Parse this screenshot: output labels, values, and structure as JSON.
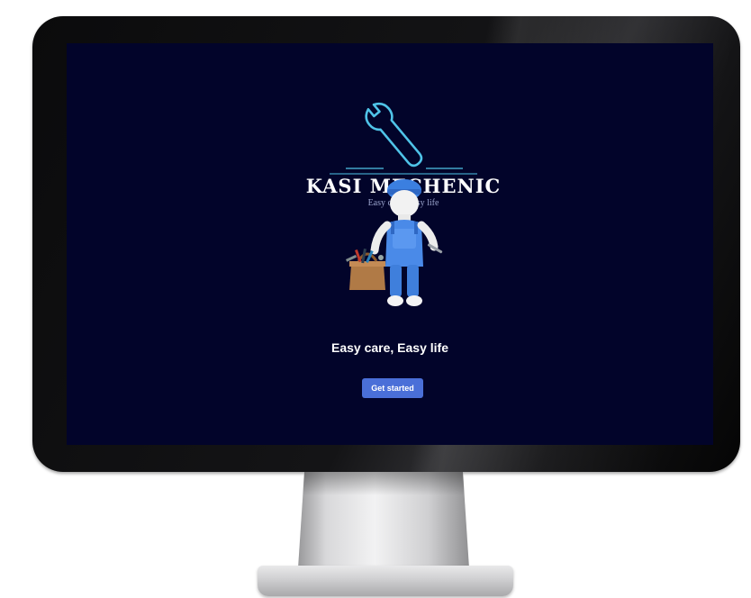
{
  "brand": {
    "name": "KASI MECHENIC",
    "tagline": "Easy care, Easy life",
    "logo_icon": "wrench-icon",
    "accent_color": "#4fc3e8"
  },
  "hero": {
    "illustration": "mechanic-with-toolbox",
    "tagline": "Easy care, Easy life"
  },
  "cta": {
    "label": "Get started",
    "color": "#4a6fd8"
  },
  "theme": {
    "screen_background": "#02042a"
  }
}
